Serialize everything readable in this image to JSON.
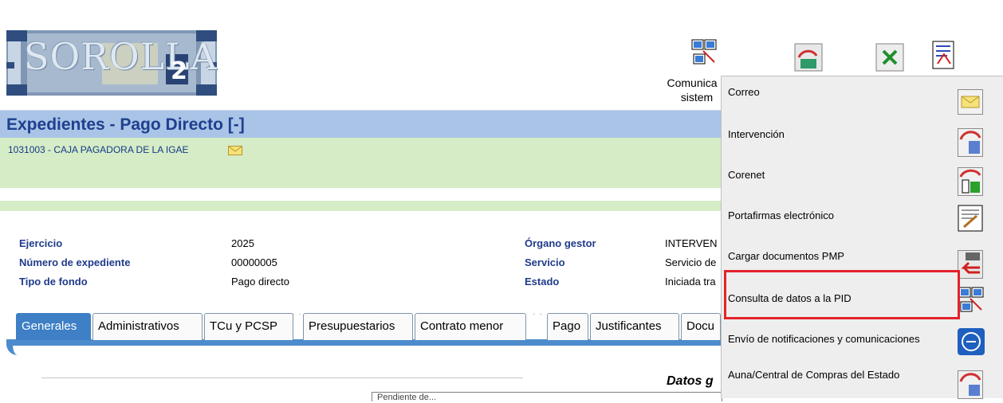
{
  "logo": {
    "text": "SOROLLA",
    "suffix": "2"
  },
  "toolbar": {
    "comunica_line1": "Comunica",
    "comunica_line2": "sistem",
    "icons": [
      "communications-icon",
      "forward-icon",
      "excel-icon",
      "report-icon"
    ]
  },
  "page": {
    "title": "Expedientes - Pago Directo [-]",
    "org": "1031003 - CAJA PAGADORA DE LA IGAE"
  },
  "details": {
    "ejercicio_label": "Ejercicio",
    "ejercicio_value": "2025",
    "numero_label": "Número de expediente",
    "numero_value": "00000005",
    "tipo_label": "Tipo de fondo",
    "tipo_value": "Pago directo",
    "organo_label": "Órgano gestor",
    "organo_value": "INTERVEN",
    "servicio_label": "Servicio",
    "servicio_value": "Servicio de",
    "estado_label": "Estado",
    "estado_value": "Iniciada tra"
  },
  "tabs": [
    {
      "label": "Generales"
    },
    {
      "label": "Administrativos"
    },
    {
      "label": "TCu y PCSP"
    },
    {
      "label": "Presupuestarios"
    },
    {
      "label": "Contrato menor"
    },
    {
      "label": "Pago"
    },
    {
      "label": "Justificantes"
    },
    {
      "label": "Docu"
    }
  ],
  "section": {
    "heading": "Datos g",
    "input_value": "Pendiente de..."
  },
  "menu": {
    "items": [
      {
        "label": "Correo",
        "icon": "envelope-icon"
      },
      {
        "label": "Intervención",
        "icon": "intervencion-icon"
      },
      {
        "label": "Corenet",
        "icon": "corenet-icon"
      },
      {
        "label": "Portafirmas electrónico",
        "icon": "portafirmas-icon"
      },
      {
        "label": "Cargar documentos PMP",
        "icon": "upload-pmp-icon"
      },
      {
        "label": "Consulta de datos a la PID",
        "icon": "pid-query-icon"
      },
      {
        "label": "Envío de notificaciones y comunicaciones",
        "icon": "notifica-icon"
      },
      {
        "label": "Auna/Central de Compras del Estado",
        "icon": "central-compras-icon"
      }
    ],
    "highlight_color": "#e4222b"
  }
}
